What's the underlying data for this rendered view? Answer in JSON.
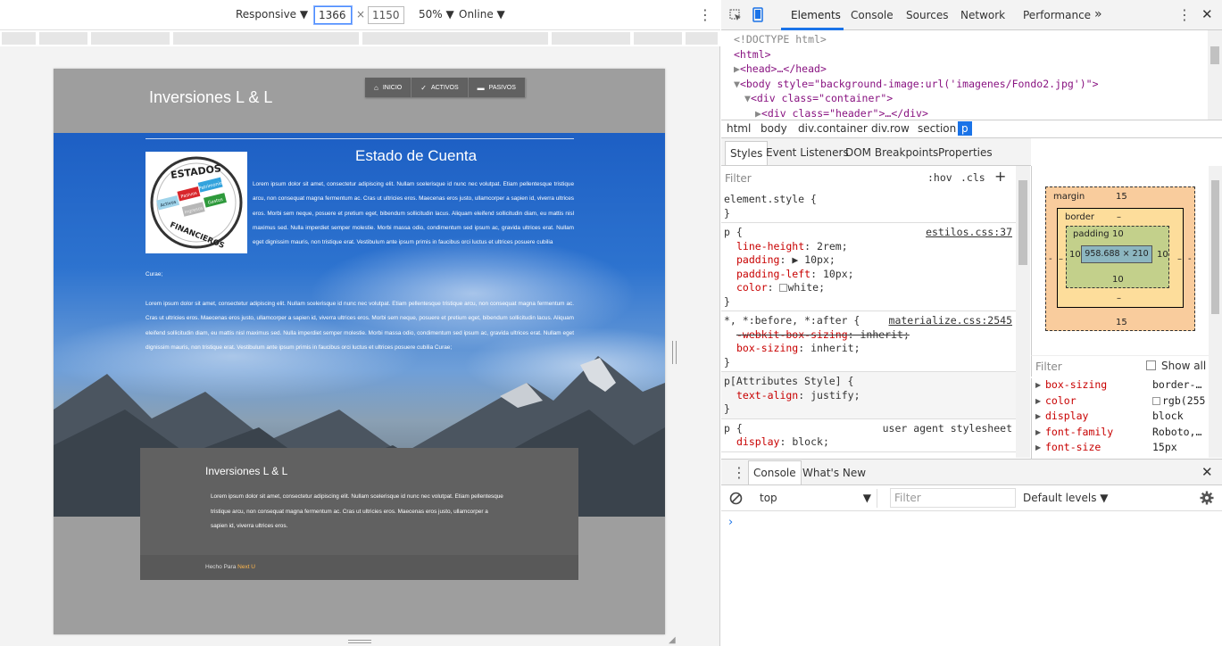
{
  "device_toolbar": {
    "mode": "Responsive",
    "width": "1366",
    "height": "1150",
    "times": "×",
    "zoom": "50%",
    "network": "Online",
    "caret": "▼"
  },
  "site": {
    "brand": "Inversiones L & L",
    "nav": [
      {
        "icon": "home-icon",
        "glyph": "⌂",
        "label": "INICIO"
      },
      {
        "icon": "check-icon",
        "glyph": "✓",
        "label": "ACTIVOS"
      },
      {
        "icon": "card-icon",
        "glyph": "▬",
        "label": "PASIVOS"
      }
    ],
    "section_title": "Estado de Cuenta",
    "logo": {
      "top": "ESTADOS",
      "bottom": "FINANCIEROS",
      "tiles": [
        "Activos",
        "Pasivos",
        "Patrimonio",
        "Ingresos",
        "Gastos"
      ]
    },
    "p1": "Lorem ipsum dolor sit amet, consectetur adipiscing elit. Nullam scelerisque id nunc nec volutpat. Etiam pellentesque tristique arcu, non consequat magna fermentum ac. Cras ut ultricies eros. Maecenas eros justo, ullamcorper a sapien id, viverra ultrices eros. Morbi sem neque, posuere et pretium eget, bibendum sollicitudin lacus. Aliquam eleifend sollicitudin diam, eu mattis nisl maximus sed. Nulla imperdiet semper molestie. Morbi massa odio, condimentum sed ipsum ac, gravida ultrices erat. Nullam eget dignissim mauris, non tristique erat. Vestibulum ante ipsum primis in faucibus orci luctus et ultrices posuere cubilia",
    "p1_tail": "Curae;",
    "p2": "Lorem ipsum dolor sit amet, consectetur adipiscing elit. Nullam scelerisque id nunc nec volutpat. Etiam pellentesque tristique arcu, non consequat magna fermentum ac. Cras ut ultricies eros. Maecenas eros justo, ullamcorper a sapien id, viverra ultrices eros. Morbi sem neque, posuere et pretium eget, bibendum sollicitudin lacus. Aliquam eleifend sollicitudin diam, eu mattis nisl maximus sed. Nulla imperdiet semper molestie. Morbi massa odio, condimentum sed ipsum ac, gravida ultrices erat. Nullam eget dignissim mauris, non tristique erat. Vestibulum ante ipsum primis in faucibus orci luctus et ultrices posuere cubilia Curae;",
    "footer": {
      "title": "Inversiones L & L",
      "text": "Lorem ipsum dolor sit amet, consectetur adipiscing elit. Nullam scelerisque id nunc nec volutpat. Etiam pellentesque tristique arcu, non consequat magna fermentum ac. Cras ut ultricies eros. Maecenas eros justo, ullamcorper a sapien id, viverra ultrices eros.",
      "made_by": "Hecho Para",
      "made_by_brand": "Next U"
    }
  },
  "devtools": {
    "tabs": [
      "Elements",
      "Console",
      "Sources",
      "Network",
      "Performance"
    ],
    "more": "»",
    "dom": [
      "<!DOCTYPE html>",
      "<html>",
      "<head>…</head>",
      "<body style=\"background-image:url('imagenes/Fondo2.jpg')\">",
      "<div class=\"container\">",
      "<div class=\"header\">…</div>"
    ],
    "breadcrumbs": [
      "html",
      "body",
      "div.container",
      "div.row",
      "section",
      "p"
    ],
    "subtabs": [
      "Styles",
      "Event Listeners",
      "DOM Breakpoints",
      "Properties"
    ],
    "filter_placeholder": "Filter",
    "hov": ":hov",
    "cls": ".cls",
    "plus": "+",
    "rules": {
      "element_style": "element.style {",
      "close": "}",
      "p_selector": "p {",
      "p_source": "estilos.css:37",
      "p_props": [
        {
          "name": "line-height",
          "value": "2rem;"
        },
        {
          "name": "padding",
          "value": "▶ 10px;"
        },
        {
          "name": "padding-left",
          "value": "10px;"
        },
        {
          "name": "color",
          "value": "white;"
        }
      ],
      "universal_selector": "*, *:before, *:after {",
      "universal_source": "materialize.css:2545",
      "universal_props": [
        {
          "name": "-webkit-box-sizing",
          "value": "inherit;"
        },
        {
          "name": "box-sizing",
          "value": "inherit;"
        }
      ],
      "attr_selector": "p[Attributes Style] {",
      "attr_props": [
        {
          "name": "text-align",
          "value": "justify;"
        }
      ],
      "ua_selector": "p {",
      "ua_source": "user agent stylesheet",
      "ua_props": [
        {
          "name": "display",
          "value": "block;"
        }
      ]
    },
    "box_model": {
      "margin_label": "margin",
      "margin": "15",
      "margin_side": "-",
      "border_label": "border",
      "border": "–",
      "padding_label": "padding",
      "padding": "10",
      "content": "958.688 × 210"
    },
    "computed_filter": "Filter",
    "show_all": "Show all",
    "computed": [
      {
        "name": "box-sizing",
        "value": "border-…"
      },
      {
        "name": "color",
        "value": "rgb(255"
      },
      {
        "name": "display",
        "value": "block"
      },
      {
        "name": "font-family",
        "value": "Roboto,…"
      },
      {
        "name": "font-size",
        "value": "15px"
      }
    ],
    "drawer_tabs": [
      "Console",
      "What's New"
    ],
    "console_context": "top",
    "console_filter": "Filter",
    "default_levels": "Default levels",
    "prompt": "›"
  }
}
